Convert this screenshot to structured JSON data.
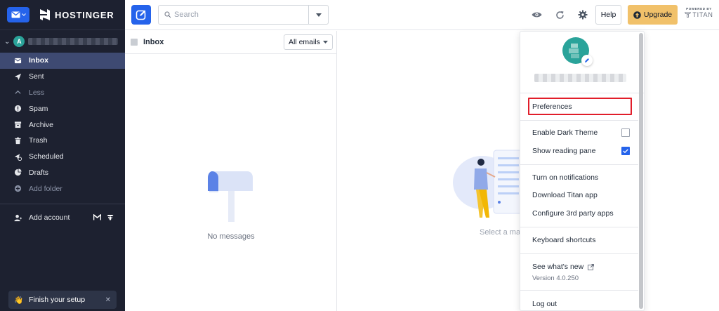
{
  "sidebar": {
    "brand": "HOSTINGER",
    "account_initial": "A",
    "folders": [
      {
        "label": "Inbox",
        "icon": "inbox-icon",
        "active": true
      },
      {
        "label": "Sent",
        "icon": "send-icon"
      },
      {
        "label": "Less",
        "icon": "chevron-up-icon",
        "dim": true
      },
      {
        "label": "Spam",
        "icon": "spam-icon"
      },
      {
        "label": "Archive",
        "icon": "archive-icon"
      },
      {
        "label": "Trash",
        "icon": "trash-icon"
      },
      {
        "label": "Scheduled",
        "icon": "scheduled-icon"
      },
      {
        "label": "Drafts",
        "icon": "drafts-icon"
      },
      {
        "label": "Add folder",
        "icon": "add-folder-icon",
        "dim": true
      }
    ],
    "add_account": "Add account",
    "finish_setup": "Finish your setup"
  },
  "toolbar": {
    "search_placeholder": "Search",
    "help_label": "Help",
    "upgrade_label": "Upgrade",
    "powered_by": "POWERED BY",
    "powered_brand": "TITAN"
  },
  "list": {
    "title": "Inbox",
    "filter": "All emails",
    "empty_text": "No messages"
  },
  "reading": {
    "empty_text": "Select a ma"
  },
  "menu": {
    "preferences": "Preferences",
    "dark_theme": "Enable Dark Theme",
    "dark_theme_checked": false,
    "reading_pane": "Show reading pane",
    "reading_pane_checked": true,
    "notifications": "Turn on notifications",
    "download_app": "Download Titan app",
    "third_party": "Configure 3rd party apps",
    "shortcuts": "Keyboard shortcuts",
    "whats_new": "See what's new",
    "version": "Version 4.0.250",
    "logout": "Log out"
  },
  "colors": {
    "sidebar_bg": "#1d2130",
    "active_folder": "#3e4a72",
    "primary": "#2563eb",
    "upgrade": "#f1c16a",
    "highlight_box": "#e11d2a"
  }
}
